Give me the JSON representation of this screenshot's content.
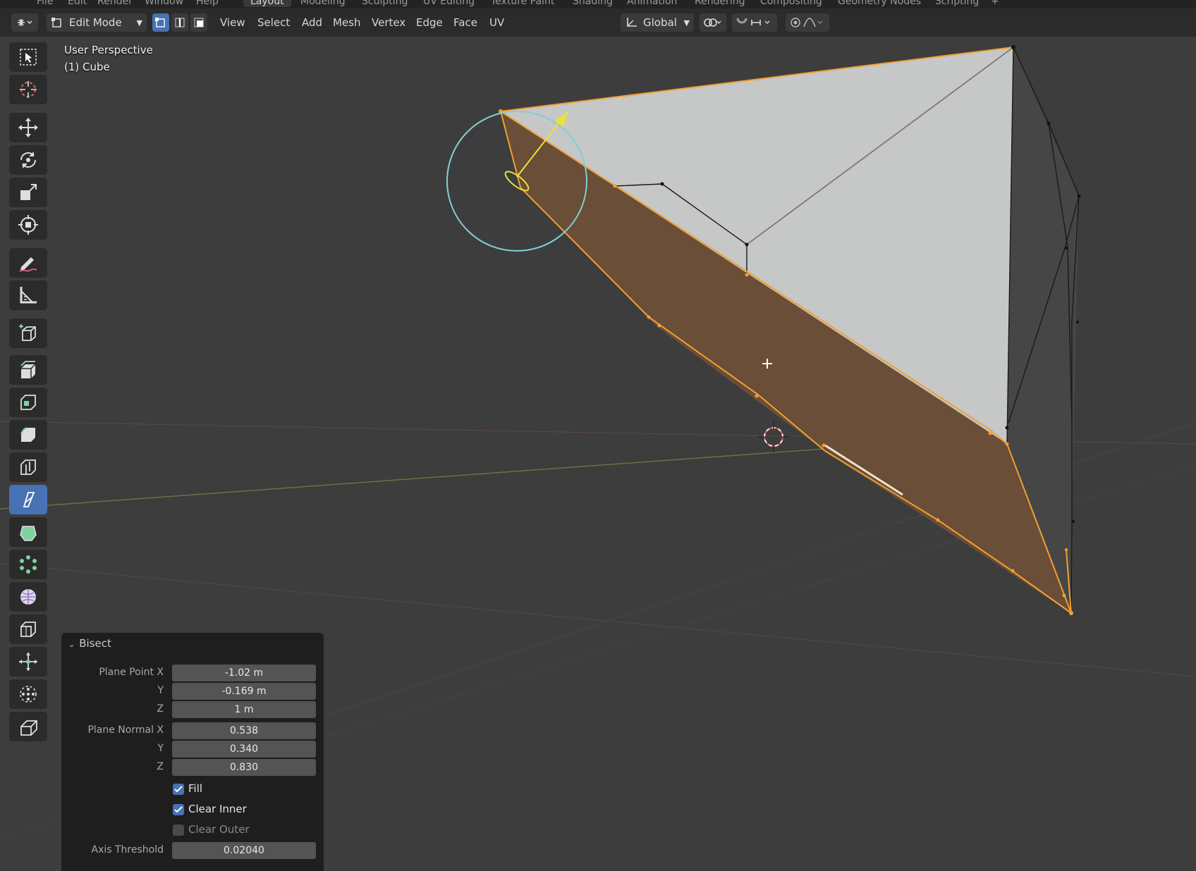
{
  "workspace_tabs": [
    "File",
    "Edit",
    "Render",
    "Window",
    "Help",
    "Layout",
    "Modeling",
    "Sculpting",
    "UV Editing",
    "Texture Paint",
    "Shading",
    "Animation",
    "Rendering",
    "Compositing",
    "Geometry Nodes",
    "Scripting",
    "+"
  ],
  "header": {
    "mode": "Edit Mode",
    "menus": [
      "View",
      "Select",
      "Add",
      "Mesh",
      "Vertex",
      "Edge",
      "Face",
      "UV"
    ],
    "transform_orientation": "Global",
    "select_mode_active": "vertex"
  },
  "viewport": {
    "view_name": "User Perspective",
    "object_label": "(1) Cube",
    "background": "#3d3d3d",
    "selection_color": "#f0a030",
    "face_color": "#6a4e38",
    "gizmo_circle_color": "#7fd1d4",
    "gizmo_arrow_color": "#e8e23c"
  },
  "toolbar": {
    "tools": [
      "select-box-icon",
      "cursor-icon",
      "move-icon",
      "rotate-icon",
      "scale-icon",
      "transform-icon",
      "annotate-icon",
      "measure-icon",
      "add-cube-icon",
      "extrude-icon",
      "inset-icon",
      "bevel-icon",
      "loop-cut-icon",
      "knife-icon",
      "poly-build-icon",
      "spin-icon",
      "smooth-icon",
      "edge-slide-icon",
      "shrink-fatten-icon",
      "shear-icon",
      "rip-icon"
    ],
    "active_tool": "knife-icon"
  },
  "bisect_panel": {
    "title": "Bisect",
    "plane_point_label": "Plane Point X",
    "plane_point": {
      "x": "-1.02 m",
      "y": "-0.169 m",
      "z": "1 m"
    },
    "plane_normal_label": "Plane Normal X",
    "plane_normal": {
      "x": "0.538",
      "y": "0.340",
      "z": "0.830"
    },
    "y_label": "Y",
    "z_label": "Z",
    "fill_label": "Fill",
    "fill": true,
    "clear_inner_label": "Clear Inner",
    "clear_inner": true,
    "clear_outer_label": "Clear Outer",
    "clear_outer": false,
    "axis_threshold_label": "Axis Threshold",
    "axis_threshold": "0.02040"
  }
}
